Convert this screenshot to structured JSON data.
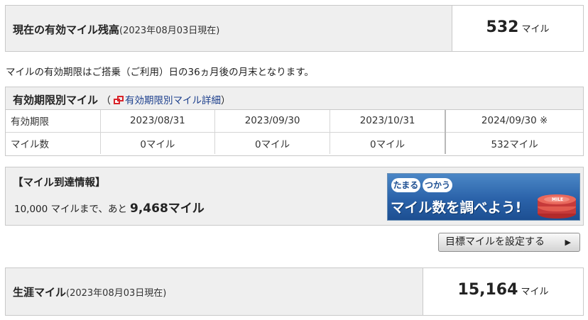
{
  "current_balance": {
    "label": "現在の有効マイル残高",
    "as_of": "(2023年08月03日現在)",
    "value": "532",
    "unit": "マイル"
  },
  "expiry_note": "マイルの有効期限はご搭乗（ご利用）日の36ヵ月後の月末となります。",
  "expiry_table": {
    "title": "有効期限別マイル",
    "paren_open": "（",
    "link_label": "有効期限別マイル詳細",
    "paren_close": "）",
    "rows": [
      [
        "有効期限",
        "2023/08/31",
        "2023/09/30",
        "2023/10/31",
        "2024/09/30 ※"
      ],
      [
        "マイル数",
        "0マイル",
        "0マイル",
        "0マイル",
        "532マイル"
      ]
    ]
  },
  "reach_info": {
    "title": "【マイル到達情報】",
    "prefix": "10,000 マイルまで、あと",
    "remaining": "9,468マイル",
    "banner": {
      "tag1": "たまる",
      "tag2": "つかう",
      "headline": "マイル数を調べよう!",
      "coin_label": "MILE"
    }
  },
  "set_target_button": {
    "label": "目標マイルを設定する",
    "arrow": "▶"
  },
  "lifetime": {
    "label": "生涯マイル",
    "as_of": "(2023年08月03日現在)",
    "value": "15,164",
    "unit": "マイル"
  },
  "colors": {
    "panel_bg": "#efefef",
    "border": "#c9c9c9",
    "link": "#1b3e8c",
    "external_icon": "#d9242a",
    "banner_blue": "#2a62a9"
  },
  "icons": [
    "external-link-icon",
    "play-arrow-icon",
    "mile-coins-icon"
  ]
}
